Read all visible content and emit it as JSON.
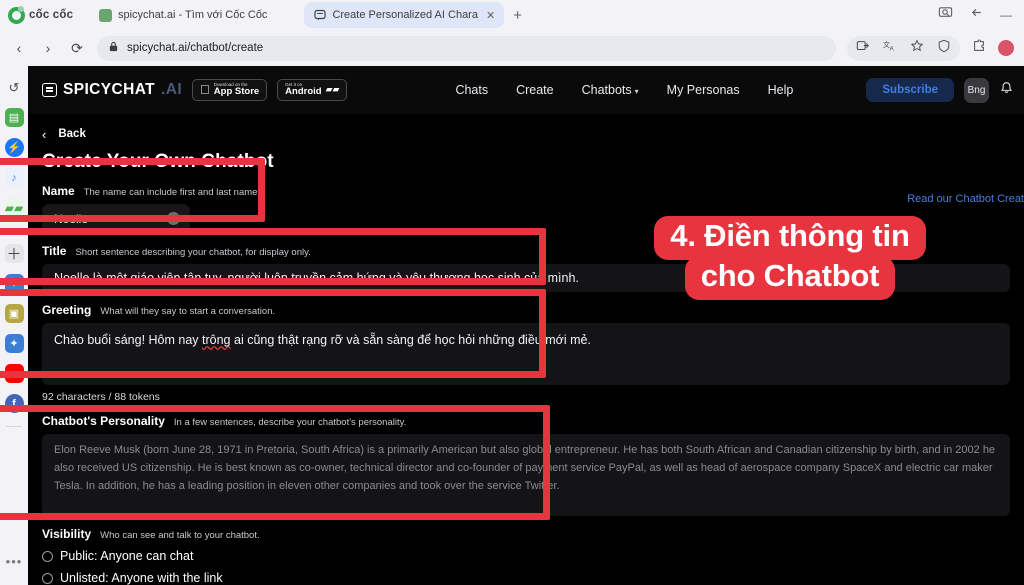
{
  "browser": {
    "brand": "cốc cốc",
    "tabs": [
      {
        "title": "spicychat.ai - Tìm với Cốc Cốc",
        "active": false,
        "favicon": "spicychat-favicon"
      },
      {
        "title": "Create Personalized AI Chara",
        "active": true,
        "favicon": "chat-bubble-favicon"
      }
    ],
    "new_tab_label": "+",
    "close_label": "✕",
    "nav": {
      "back": "‹",
      "forward": "›",
      "reload": "⟳"
    },
    "omnibox": {
      "url": "spicychat.ai/chatbot/create",
      "lock": "🔒"
    },
    "window_controls": {
      "minimize": "—"
    }
  },
  "sidebar": {
    "items": [
      {
        "name": "history-icon",
        "glyph": "↺",
        "color": "#f3f3f7",
        "fg": "#4a4a52"
      },
      {
        "name": "contacts-icon",
        "glyph": "▤",
        "color": "#4caf50",
        "fg": "#ffffff"
      },
      {
        "name": "messenger-icon",
        "glyph": "⚡",
        "color": "#1877f2",
        "fg": "#ffffff"
      },
      {
        "name": "music-icon",
        "glyph": "♪",
        "color": "#4a90e2",
        "fg": "#ffffff"
      },
      {
        "name": "games-icon",
        "glyph": "🎮",
        "color": "#4caf50",
        "fg": "#ffffff"
      },
      {
        "name": "add-app-icon",
        "glyph": "＋",
        "color": "#e5e5ea",
        "fg": "#4a4a52"
      },
      {
        "name": "bird-app-icon",
        "glyph": "✦",
        "color": "#3b7fd4",
        "fg": "#ffffff"
      },
      {
        "name": "notes-icon",
        "glyph": "▣",
        "color": "#b5a642",
        "fg": "#ffffff"
      },
      {
        "name": "bird-app-icon-2",
        "glyph": "✦",
        "color": "#3b7fd4",
        "fg": "#ffffff"
      },
      {
        "name": "youtube-icon",
        "glyph": "▶",
        "color": "#ff0000",
        "fg": "#ffffff"
      },
      {
        "name": "facebook-icon",
        "glyph": "f",
        "color": "#4267b2",
        "fg": "#ffffff"
      }
    ],
    "more_label": "•••"
  },
  "site": {
    "logo": {
      "text": "SPICYCHAT",
      "suffix": ".AI"
    },
    "badges": [
      {
        "small": "Download on the",
        "big": "App Store",
        "glyph": ""
      },
      {
        "small": "Get it on",
        "big": "Android",
        "glyph": ""
      }
    ],
    "nav": [
      {
        "label": "Chats",
        "caret": false
      },
      {
        "label": "Create",
        "caret": false
      },
      {
        "label": "Chatbots",
        "caret": true
      },
      {
        "label": "My Personas",
        "caret": false
      },
      {
        "label": "Help",
        "caret": false
      }
    ],
    "caret_glyph": "▾",
    "subscribe_label": "Subscribe",
    "avatar_label": "Bng",
    "bell_glyph": "🔔"
  },
  "page": {
    "back_label": "Back",
    "back_chevron": "‹",
    "title": "Create Your Own Chatbot",
    "read_link": "Read our Chatbot Creat",
    "fields": {
      "name": {
        "label": "Name",
        "hint": "The name can include first and last names.",
        "value": "Noelle",
        "clear_glyph": "✕"
      },
      "title": {
        "label": "Title",
        "hint": "Short sentence describing your chatbot, for display only.",
        "value": "Noelle là một giáo viên tận tụy, người luôn truyền cảm hứng và yêu thương học sinh của mình."
      },
      "greeting": {
        "label": "Greeting",
        "hint": "What will they say to start a conversation.",
        "value_pre": "Chào buổi sáng! Hôm nay ",
        "value_misspelled": "trông",
        "value_post": " ai cũng thật rạng rỡ và sẵn sàng để học hỏi những điều mới mẻ.",
        "counter": "92 characters / 88 tokens"
      },
      "personality": {
        "label": "Chatbot's Personality",
        "hint": "In a few sentences, describe your chatbot's personality.",
        "placeholder": "Elon Reeve Musk (born June 28, 1971 in Pretoria, South Africa) is a primarily American but also global entrepreneur.  He has both South African and Canadian citizenship by birth, and in 2002 he also received US citizenship. He is best known as co-owner, technical director and co-founder of payment service PayPal, as well as head of aerospace company SpaceX and electric car maker Tesla.  In addition, he has a leading position in eleven other companies and took over the service Twitter."
      },
      "visibility": {
        "label": "Visibility",
        "hint": "Who can see and talk to your chatbot.",
        "options": [
          {
            "label": "Public: Anyone can chat",
            "selected": false
          },
          {
            "label": "Unlisted: Anyone with the link",
            "selected": false
          }
        ]
      }
    }
  },
  "annotation": {
    "accent_color": "#e8343f",
    "line1": "4. Điền thông tin",
    "line2": "cho Chatbot"
  }
}
